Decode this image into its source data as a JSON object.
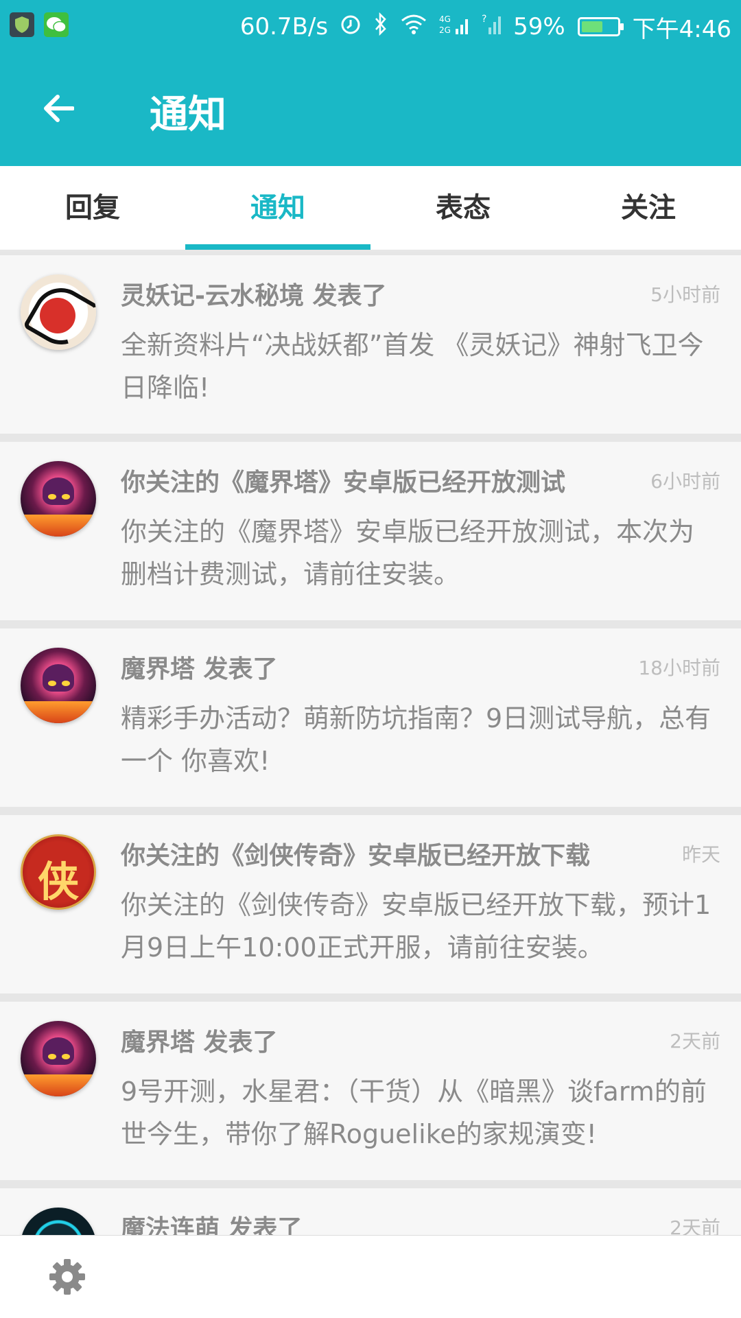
{
  "status_bar": {
    "speed": "60.7B/s",
    "network": "4G 2G",
    "battery": "59%",
    "battery_level": 0.59,
    "time": "下午4:46"
  },
  "app_bar": {
    "title": "通知",
    "back_icon": "arrow-left-icon"
  },
  "tabs": [
    {
      "label": "回复",
      "active": false
    },
    {
      "label": "通知",
      "active": true
    },
    {
      "label": "表态",
      "active": false
    },
    {
      "label": "关注",
      "active": false
    }
  ],
  "notifications": [
    {
      "title": "灵妖记-云水秘境 发表了",
      "time": "5小时前",
      "body": "全新资料片“决战妖都”首发 《灵妖记》神射飞卫今日降临!",
      "avatar": "lingyaoji"
    },
    {
      "title": "你关注的《魔界塔》安卓版已经开放测试",
      "time": "6小时前",
      "body": "你关注的《魔界塔》安卓版已经开放测试，本次为删档计费测试，请前往安装。",
      "avatar": "mojieta"
    },
    {
      "title": "魔界塔 发表了",
      "time": "18小时前",
      "body": "精彩手办活动？萌新防坑指南？9日测试导航，总有一个 你喜欢!",
      "avatar": "mojieta"
    },
    {
      "title": "你关注的《剑侠传奇》安卓版已经开放下载",
      "time": "昨天",
      "body": "你关注的《剑侠传奇》安卓版已经开放下载，预计1月9日上午10:00正式开服，请前往安装。",
      "avatar": "jianxia"
    },
    {
      "title": "魔界塔 发表了",
      "time": "2天前",
      "body": "9号开测，水星君：（干货）从《暗黑》谈farm的前世今生，带你了解Roguelike的家规演变!",
      "avatar": "mojieta"
    },
    {
      "title": "魔法连萌 发表了",
      "time": "2天前",
      "body": "",
      "avatar": "mofa"
    }
  ],
  "bottom_bar": {
    "settings_icon": "gear-icon"
  },
  "colors": {
    "accent": "#1ab8c6",
    "battery_fill": "#6ee07a"
  }
}
